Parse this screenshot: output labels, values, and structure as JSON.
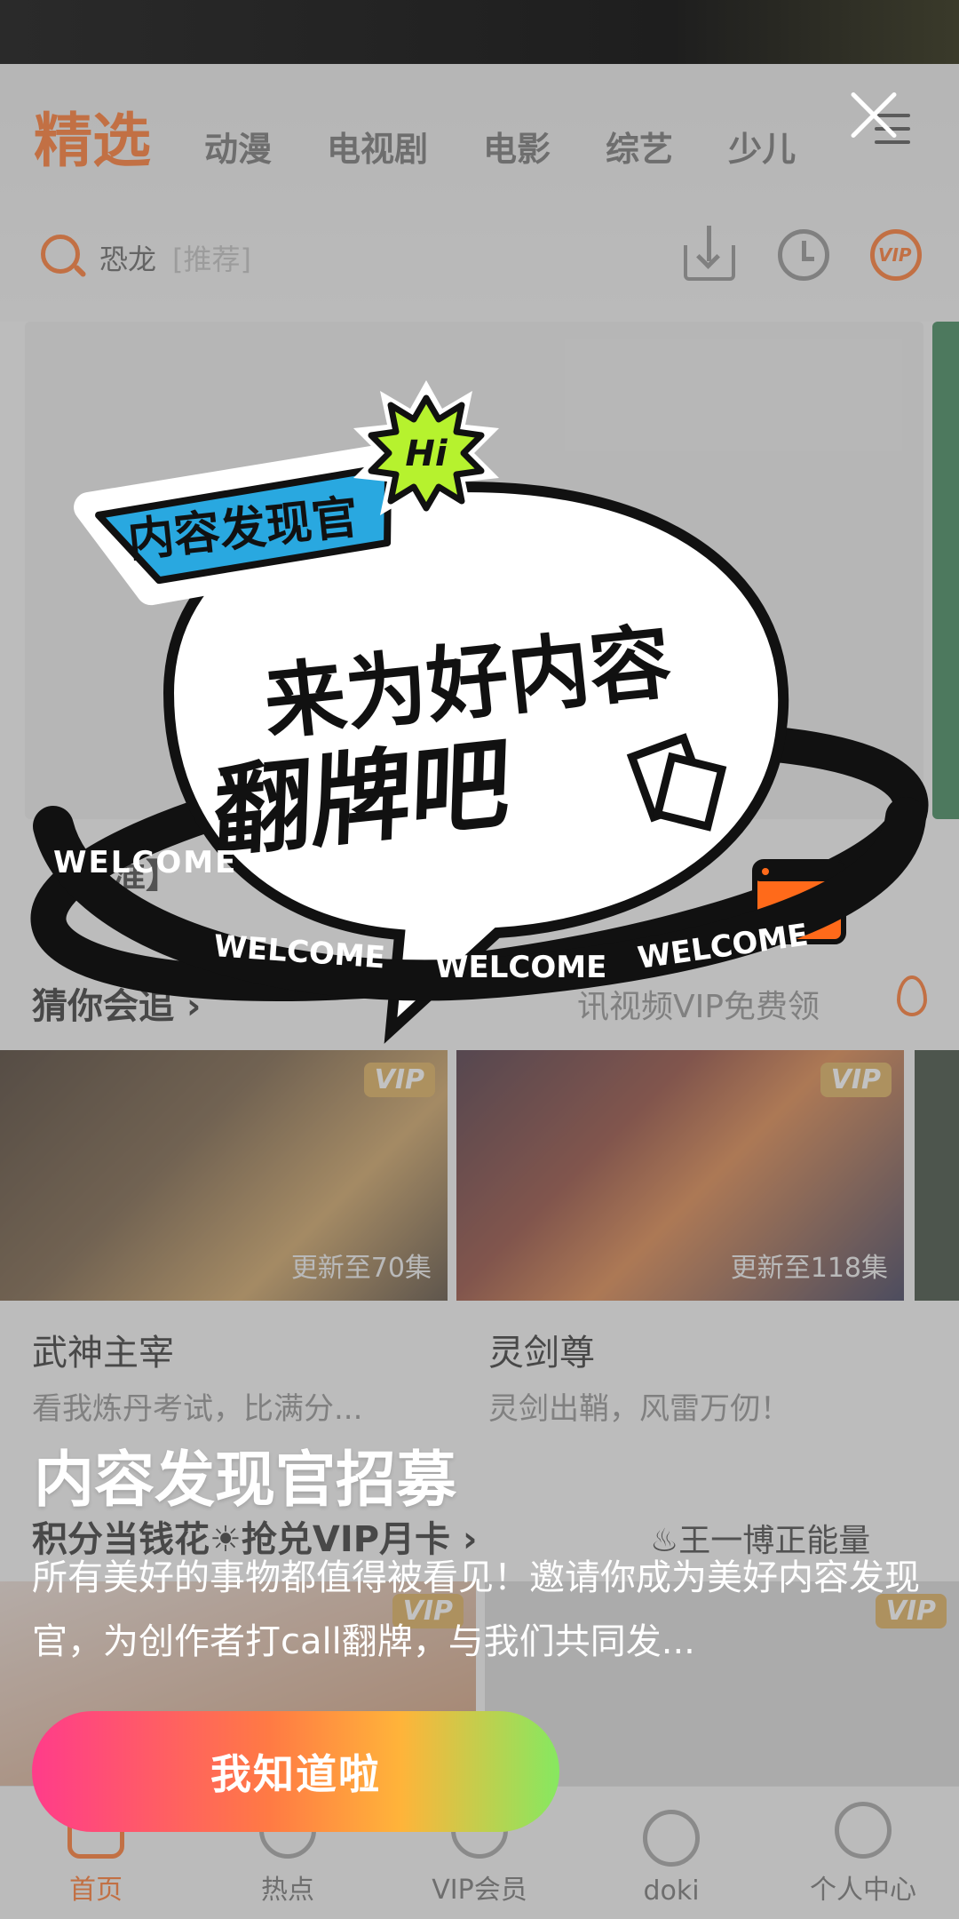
{
  "top_nav": {
    "tabs": [
      "精选",
      "动漫",
      "电视剧",
      "电影",
      "综艺",
      "少儿"
    ],
    "active_tab": "精选"
  },
  "search": {
    "value": "恐龙",
    "tag": "[推荐]"
  },
  "banner": {
    "caption": "【瞄准】"
  },
  "section": {
    "title": "猜你会追",
    "promo": "讯视频VIP免费领"
  },
  "cards": [
    {
      "title": "武神主宰",
      "subtitle": "看我炼丹考试，比满分...",
      "episode": "更新至70集",
      "badge": "VIP"
    },
    {
      "title": "灵剑尊",
      "subtitle": "灵剑出鞘，风雷万仞！",
      "episode": "更新至118集",
      "badge": "VIP"
    }
  ],
  "row2": {
    "left": "积分当钱花☀抢兑VIP月卡",
    "right": "♨王一博正能量",
    "badge_left": "VIP",
    "badge_right": "VIP"
  },
  "bottom_nav": [
    {
      "label": "首页",
      "active": true
    },
    {
      "label": "热点",
      "active": false
    },
    {
      "label": "VIP会员",
      "active": false
    },
    {
      "label": "doki",
      "active": false
    },
    {
      "label": "个人中心",
      "active": false
    }
  ],
  "popup": {
    "badge_hi": "Hi",
    "ribbon": "内容发现官",
    "slogan_line1": "来为好内容",
    "slogan_line2": "翻牌吧",
    "ring_text": "WELCOME",
    "title": "内容发现官招募",
    "description": "所有美好的事物都值得被看见！邀请你成为美好内容发现官，为创作者打call翻牌，与我们共同发...",
    "button": "我知道啦"
  },
  "colors": {
    "brand": "#ff6a1a",
    "ribbon": "#29a8e0",
    "hi_badge": "#b6f22e",
    "cta_start": "#ff3c8a",
    "cta_end": "#86e860"
  }
}
